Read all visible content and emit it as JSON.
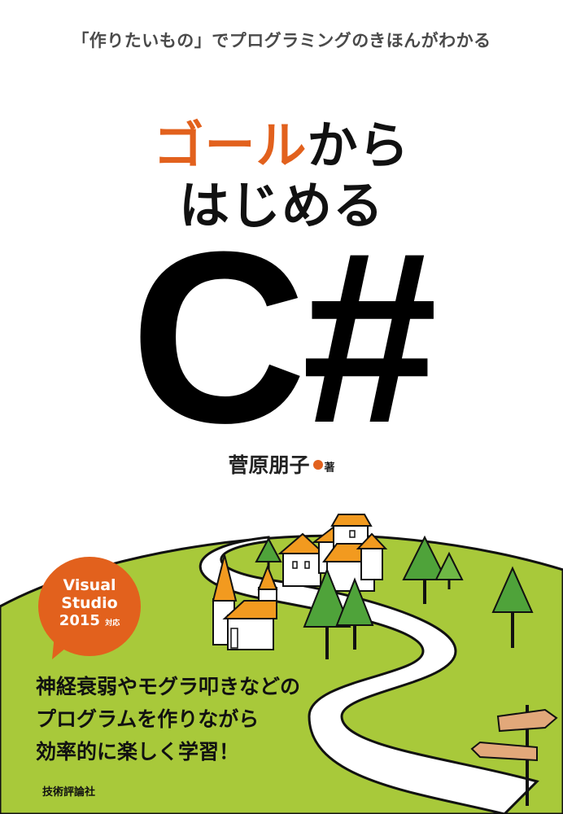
{
  "cover": {
    "tagline": "「作りたいもの」でプログラミングのきほんがわかる",
    "title_accent": "ゴール",
    "title_line1_rest": "から",
    "title_line2": "はじめる",
    "language": "C#",
    "author_name": "菅原朋子",
    "author_suffix": "著",
    "badge": {
      "line1": "Visual",
      "line2": "Studio",
      "line3_version": "2015",
      "line3_suffix": "対応"
    },
    "description": [
      "神経衰弱やモグラ叩きなどの",
      "プログラムを作りながら",
      "効率的に楽しく学習！"
    ],
    "publisher": "技術評論社"
  },
  "colors": {
    "accent": "#e2611d",
    "grass": "#a8c93a",
    "tree": "#4fa33a",
    "roof": "#f29a1f",
    "signpost": "#e2a87a"
  }
}
